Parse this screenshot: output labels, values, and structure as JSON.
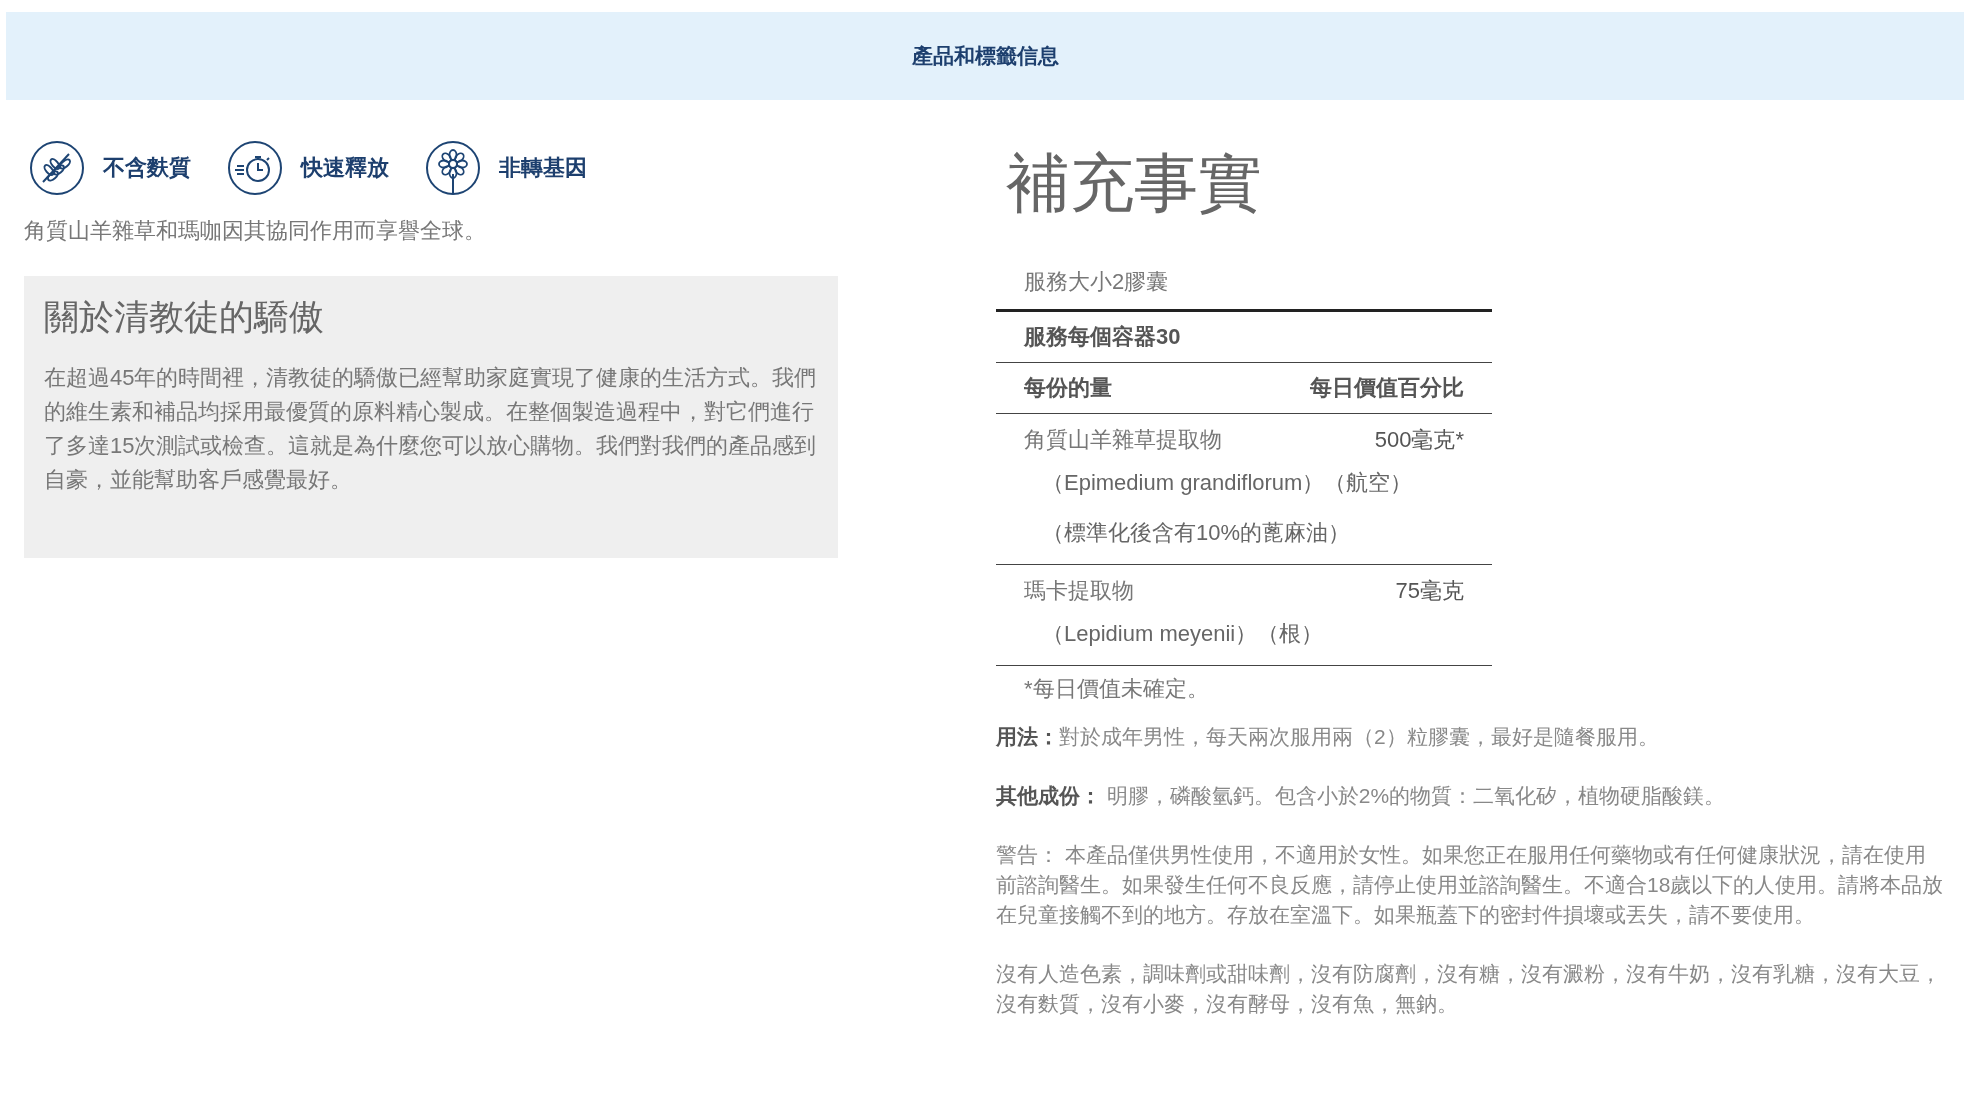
{
  "banner": {
    "title": "產品和標籤信息"
  },
  "features": [
    {
      "kind": "wheat",
      "label": "不含麩質"
    },
    {
      "kind": "timer",
      "label": "快速釋放"
    },
    {
      "kind": "flower",
      "label": "非轉基因"
    }
  ],
  "tagline": "角質山羊雜草和瑪咖因其協同作用而享譽全球。",
  "about": {
    "heading": "關於清教徒的驕傲",
    "body": "在超過45年的時間裡，清教徒的驕傲已經幫助家庭實現了健康的生活方式。我們的維生素和補品均採用最優質的原料精心製成。在整個製造過程中，對它們進行了多達15次測試或檢查。這就是為什麼您可以放心購物。我們對我們的產品感到自豪，並能幫助客戶感覺最好。"
  },
  "facts": {
    "title": "補充事實",
    "serving_size": "服務大小2膠囊",
    "servings_per_container": "服務每個容器30",
    "header": {
      "amount": "每份的量",
      "daily_value": "每日價值百分比"
    },
    "ingredients": [
      {
        "name": "角質山羊雜草提取物",
        "amount": "500毫克*",
        "details": [
          "（Epimedium grandiflorum）（航空）",
          "（標準化後含有10%的蓖麻油）"
        ]
      },
      {
        "name": "瑪卡提取物",
        "amount": "75毫克",
        "details": [
          "（Lepidium meyenii）（根）"
        ]
      }
    ],
    "footnote": "*每日價值未確定。"
  },
  "notes": [
    "**用法：**對於成年男性，每天兩次服用兩（2）粒膠囊，最好是隨餐服用。",
    "**其他成份：** 明膠，磷酸氫鈣。包含小於2%的物質：二氧化矽，植物硬脂酸鎂。",
    "警告： 本產品僅供男性使用，不適用於女性。如果您正在服用任何藥物或有任何健康狀況，請在使用前諮詢醫生。如果發生任何不良反應，請停止使用並諮詢醫生。不適合18歲以下的人使用。請將本品放在兒童接觸不到的地方。存放在室溫下。如果瓶蓋下的密封件損壞或丟失，請不要使用。",
    "沒有人造色素，調味劑或甜味劑，沒有防腐劑，沒有糖，沒有澱粉，沒有牛奶，沒有乳糖，沒有大豆，沒有麩質，沒有小麥，沒有酵母，沒有魚，無鈉。"
  ]
}
